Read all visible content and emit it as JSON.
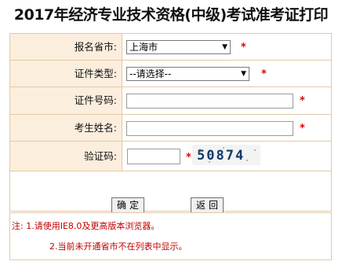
{
  "header": {
    "title": "2017年经济专业技术资格(中级)考试准考证打印"
  },
  "form": {
    "province": {
      "label": "报名省市:",
      "selected": "上海市"
    },
    "cert_type": {
      "label": "证件类型:",
      "selected": "--请选择--"
    },
    "cert_number": {
      "label": "证件号码:",
      "value": ""
    },
    "name": {
      "label": "考生姓名:",
      "value": ""
    },
    "captcha": {
      "label": "验证码:",
      "value": "",
      "image_text": "50874"
    },
    "required_mark": "*",
    "confirm_label": "确定",
    "back_label": "返回"
  },
  "notes": {
    "line1": "注: 1.请使用IE8.0及更高版本浏览器。",
    "line2": "2.当前未开通省市不在列表中显示。"
  },
  "colors": {
    "label_bg": "#fbeedd",
    "border": "#e3c9a6",
    "required": "#e00000",
    "note": "#c00000"
  },
  "icons": {
    "dropdown": "triangle-down-icon"
  }
}
